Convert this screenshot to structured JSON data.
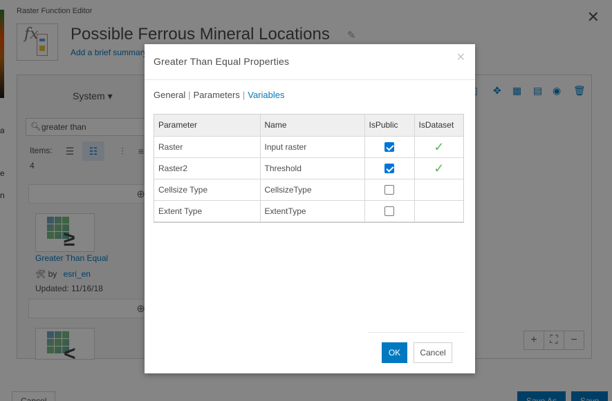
{
  "editor": {
    "caption": "Raster Function Editor",
    "title": "Possible Ferrous Mineral Locations",
    "description_link": "Add a brief summary",
    "system_dropdown": "System",
    "search_value": "greater than",
    "items_label": "Items:",
    "items_count": "4",
    "function_card": {
      "title": "Greater Than Equal",
      "by": "by",
      "owner": "esri_en",
      "updated": "Updated: 11/16/18"
    },
    "bottom_buttons": {
      "cancel": "Cancel",
      "save_as": "Save As",
      "save": "Save"
    }
  },
  "side_letters": [
    "a",
    "e",
    "n"
  ],
  "modal": {
    "title": "Greater Than Equal Properties",
    "tabs": [
      {
        "label": "General",
        "active": false
      },
      {
        "label": "Parameters",
        "active": false
      },
      {
        "label": "Variables",
        "active": true
      }
    ],
    "table": {
      "headers": [
        "Parameter",
        "Name",
        "IsPublic",
        "IsDataset"
      ],
      "rows": [
        {
          "parameter": "Raster",
          "name": "Input raster",
          "is_public": true,
          "is_dataset": true
        },
        {
          "parameter": "Raster2",
          "name": "Threshold",
          "is_public": true,
          "is_dataset": true
        },
        {
          "parameter": "Cellsize Type",
          "name": "CellsizeType",
          "is_public": false,
          "is_dataset": false
        },
        {
          "parameter": "Extent Type",
          "name": "ExtentType",
          "is_public": false,
          "is_dataset": false
        }
      ]
    },
    "ok_label": "OK",
    "cancel_label": "Cancel"
  },
  "colors": {
    "accent": "#0079c1",
    "checkbox": "#0075d8",
    "tick": "#5cb85c"
  }
}
